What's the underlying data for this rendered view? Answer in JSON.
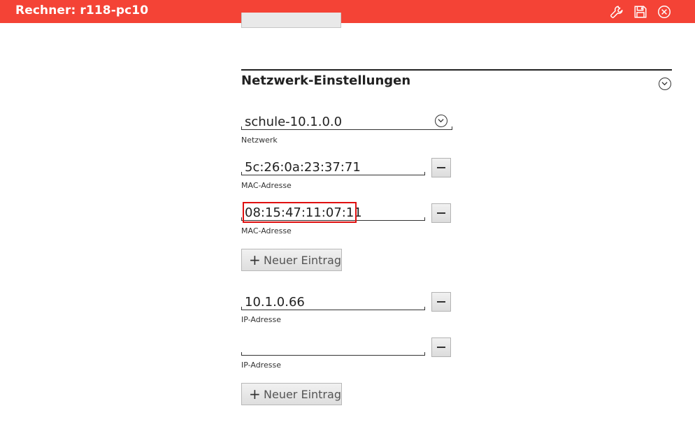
{
  "window": {
    "title": "Rechner: r118-pc10",
    "icons": [
      "wrench-icon",
      "save-icon",
      "close-icon"
    ]
  },
  "section": {
    "title": "Netzwerk-Einstellungen",
    "toggle_icon": "chevron-down-circle-icon"
  },
  "network": {
    "value": "schule-10.1.0.0",
    "label": "Netzwerk"
  },
  "mac_addresses": [
    {
      "value": "5c:26:0a:23:37:71",
      "label": "MAC-Adresse"
    },
    {
      "value": "08:15:47:11:07:11",
      "label": "MAC-Adresse"
    }
  ],
  "mac_add_button": {
    "label": "Neuer Eintrag",
    "icon": "plus-icon"
  },
  "ip_addresses": [
    {
      "value": "10.1.0.66",
      "label": "IP-Adresse"
    },
    {
      "value": "",
      "label": "IP-Adresse"
    }
  ],
  "ip_add_button": {
    "label": "Neuer Eintrag",
    "icon": "plus-icon"
  },
  "colors": {
    "titlebar": "#f44336",
    "highlight": "#e01010"
  }
}
